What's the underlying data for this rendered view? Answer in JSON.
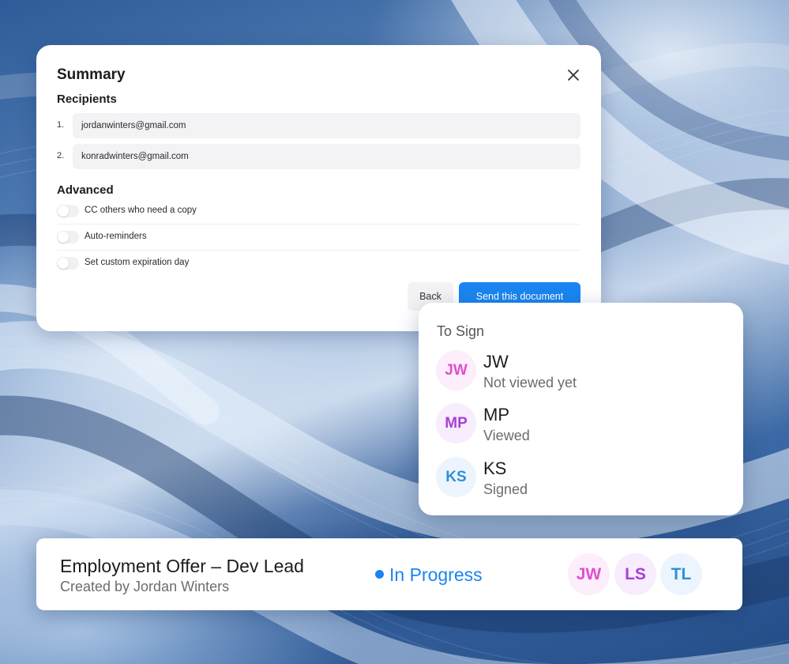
{
  "summary": {
    "title": "Summary",
    "recipients_heading": "Recipients",
    "recipients": [
      {
        "num": "1.",
        "email": "jordanwinters@gmail.com"
      },
      {
        "num": "2.",
        "email": "konradwinters@gmail.com"
      }
    ],
    "advanced_heading": "Advanced",
    "options": [
      {
        "label": "CC others who need a copy",
        "enabled": false
      },
      {
        "label": "Auto-reminders",
        "enabled": false
      },
      {
        "label": "Set custom expiration day",
        "enabled": false
      }
    ],
    "back_label": "Back",
    "send_label": "Send this document"
  },
  "to_sign": {
    "title": "To Sign",
    "signers": [
      {
        "initials": "JW",
        "status": "Not viewed yet",
        "color": "#e04fd0",
        "bg": "#fdeefb"
      },
      {
        "initials": "MP",
        "status": "Viewed",
        "color": "#a83fd8",
        "bg": "#f7edfc"
      },
      {
        "initials": "KS",
        "status": "Signed",
        "color": "#2f8fd8",
        "bg": "#ecf5fd"
      }
    ]
  },
  "document": {
    "title": "Employment Offer – Dev Lead",
    "created_by": "Created by Jordan Winters",
    "status": "In Progress",
    "status_color": "#1a85f0",
    "avatars": [
      {
        "initials": "JW",
        "color": "#e04fd0",
        "bg": "#fdeefb"
      },
      {
        "initials": "LS",
        "color": "#a83fd8",
        "bg": "#f7edfc"
      },
      {
        "initials": "TL",
        "color": "#2f8fd8",
        "bg": "#ecf5fd"
      }
    ]
  }
}
